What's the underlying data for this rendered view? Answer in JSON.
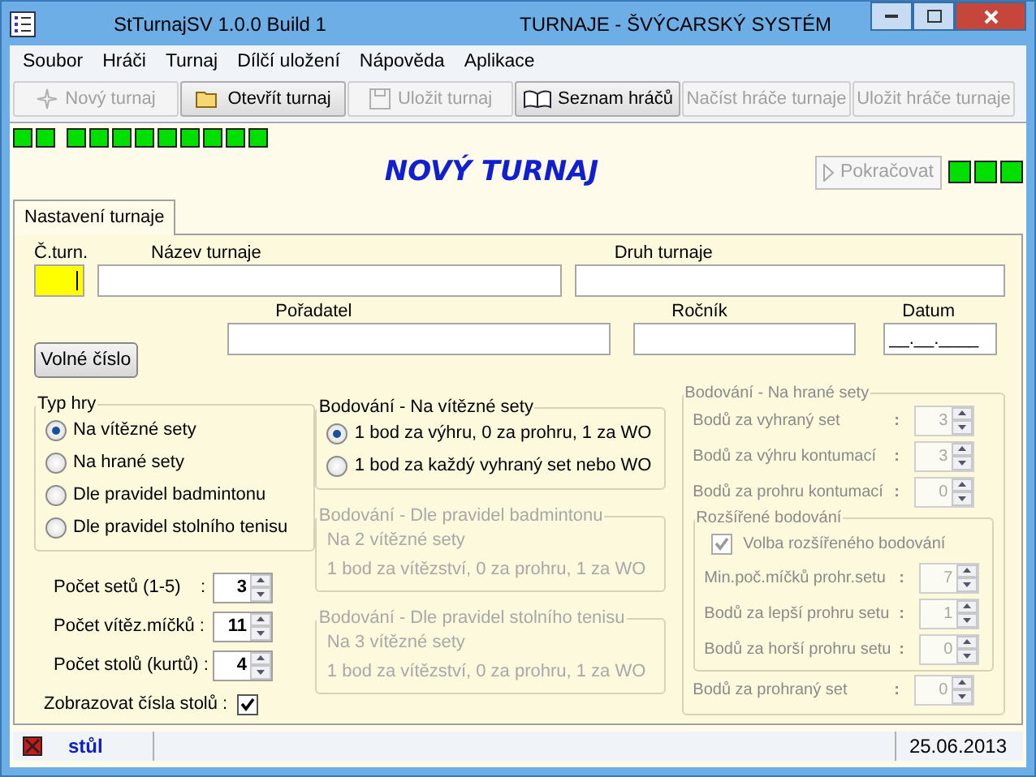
{
  "window": {
    "title_left": "StTurnajSV 1.0.0 Build 1",
    "title_right": "TURNAJE - ŠVÝCARSKÝ SYSTÉM"
  },
  "menu": [
    "Soubor",
    "Hráči",
    "Turnaj",
    "Dílčí uložení",
    "Nápověda",
    "Aplikace"
  ],
  "toolbar": [
    {
      "label": "Nový turnaj",
      "kind": "new",
      "disabled": true
    },
    {
      "label": "Otevřít turnaj",
      "kind": "open",
      "disabled": false
    },
    {
      "label": "Uložit turnaj",
      "kind": "save",
      "disabled": true
    },
    {
      "label": "Seznam hráčů",
      "kind": "book",
      "disabled": false
    },
    {
      "label": "Načíst hráče turnaje",
      "kind": "plain",
      "disabled": true
    },
    {
      "label": "Uložit hráče turnaje",
      "kind": "plain",
      "disabled": true
    }
  ],
  "indicator_groups": [
    [
      {
        "on": true
      },
      {
        "on": true
      }
    ],
    [
      {
        "on": true
      },
      {
        "on": true
      },
      {
        "on": true
      },
      {
        "on": true
      },
      {
        "on": true
      },
      {
        "on": true
      },
      {
        "on": true
      },
      {
        "on": true
      },
      {
        "on": true
      }
    ]
  ],
  "heading": "NOVÝ TURNAJ",
  "continue_button": {
    "label": "Pokračovat",
    "disabled": true
  },
  "indicators_right": [
    {
      "on": true
    },
    {
      "on": true
    },
    {
      "on": true
    }
  ],
  "tabs": [
    {
      "label": "Nastavení turnaje",
      "selected": true
    }
  ],
  "form": {
    "number_field": {
      "label": "Č.turn.",
      "focused": true
    },
    "name_field": {
      "label": "Název turnaje"
    },
    "type_field": {
      "label": "Druh turnaje"
    },
    "organizer_field": {
      "label": "Pořadatel"
    },
    "year_field": {
      "label": "Ročník"
    },
    "date_field": {
      "label": "Datum",
      "value": "__.__.____"
    },
    "free_number_button": "Volné číslo"
  },
  "game_type": {
    "title": "Typ hry",
    "options": [
      {
        "label": "Na vítězné sety",
        "selected": true
      },
      {
        "label": "Na hrané sety",
        "selected": false
      },
      {
        "label": "Dle pravidel badmintonu",
        "selected": false
      },
      {
        "label": "Dle pravidel stolního tenisu",
        "selected": false
      }
    ]
  },
  "counters": [
    {
      "label": "Počet setů (1-5)    :",
      "value": "3"
    },
    {
      "label": "Počet vítěz.míčků :",
      "value": "11"
    },
    {
      "label": "Počet stolů (kurtů) :",
      "value": "4"
    }
  ],
  "show_table_numbers": {
    "label": "Zobrazovat čísla stolů :",
    "checked": true
  },
  "scoring_groups": [
    {
      "title": "Bodování - Na vítězné sety",
      "disabled": false,
      "kind": "radio",
      "options": [
        {
          "label": "1 bod za výhru, 0 za prohru, 1 za WO",
          "selected": true
        },
        {
          "label": "1 bod za každý vyhraný set nebo WO",
          "selected": false
        }
      ]
    },
    {
      "title": "Bodování - Dle pravidel badmintonu",
      "disabled": true,
      "kind": "text",
      "lines": [
        "Na 2 vítězné sety",
        "1 bod za vítězství, 0 za prohru, 1 za WO"
      ]
    },
    {
      "title": "Bodování - Dle pravidel stolního tenisu",
      "disabled": true,
      "kind": "text",
      "lines": [
        "Na 3 vítězné sety",
        "1 bod za vítězství, 0 za prohru, 1 za WO"
      ]
    }
  ],
  "played_sets": {
    "title": "Bodování - Na hrané sety",
    "disabled": true,
    "rows": [
      {
        "label": "Bodů za vyhraný set",
        "sep": ":",
        "value": "3"
      },
      {
        "label": "Bodů za výhru kontumací",
        "sep": ":",
        "value": "3"
      },
      {
        "label": "Bodů za prohru kontumací",
        "sep": ":",
        "value": "0"
      }
    ],
    "extended": {
      "title": "Rozšířené bodování",
      "checkbox": {
        "label": "Volba rozšířeného bodování",
        "checked": true
      },
      "rows": [
        {
          "label": "Min.poč.míčků prohr.setu",
          "sep": ":",
          "value": "7"
        },
        {
          "label": "Bodů za lepší prohru setu",
          "sep": ":",
          "value": "1"
        },
        {
          "label": "Bodů za horší prohru setu",
          "sep": ":",
          "value": "0"
        }
      ]
    },
    "last_rows": [
      {
        "label": "Bodů za prohraný set",
        "sep": ":",
        "value": "0"
      }
    ]
  },
  "status_bar": {
    "label": "stůl",
    "date": "25.06.2013"
  }
}
